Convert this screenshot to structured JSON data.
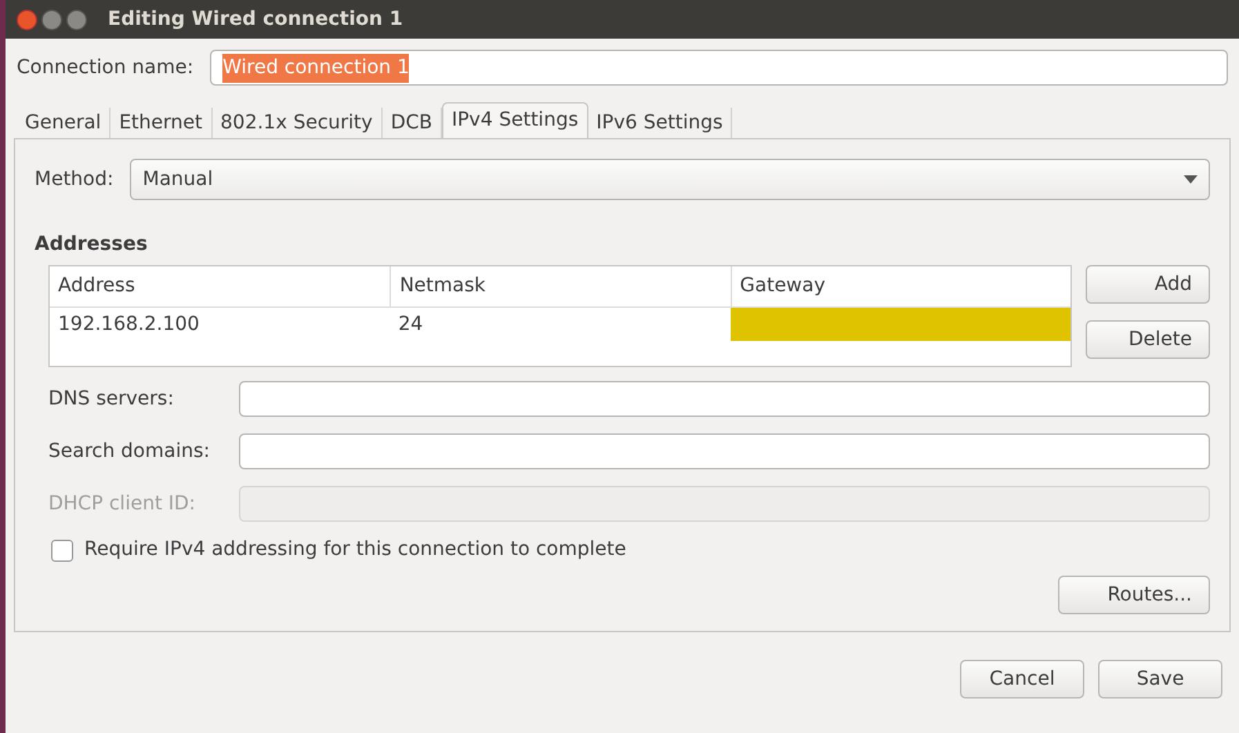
{
  "window": {
    "title": "Editing Wired connection 1"
  },
  "connection_name": {
    "label": "Connection name:",
    "value": "Wired connection 1",
    "selected_text": true
  },
  "tabs": [
    {
      "label": "General",
      "selected": false
    },
    {
      "label": "Ethernet",
      "selected": false
    },
    {
      "label": "802.1x Security",
      "selected": false
    },
    {
      "label": "DCB",
      "selected": false
    },
    {
      "label": "IPv4 Settings",
      "selected": true
    },
    {
      "label": "IPv6 Settings",
      "selected": false
    }
  ],
  "method": {
    "label": "Method:",
    "value": "Manual"
  },
  "addresses": {
    "title": "Addresses",
    "columns": [
      "Address",
      "Netmask",
      "Gateway"
    ],
    "rows": [
      {
        "cells": [
          {
            "text": "192.168.2.100",
            "editing": false
          },
          {
            "text": "24",
            "editing": false
          },
          {
            "text": "",
            "editing": true
          }
        ]
      }
    ],
    "buttons": [
      "Add",
      "Delete"
    ]
  },
  "fields": [
    {
      "label": "DNS servers:",
      "disabled": false
    },
    {
      "label": "Search domains:",
      "disabled": false
    },
    {
      "label": "DHCP client ID:",
      "disabled": true
    }
  ],
  "require_checkbox": {
    "label": "Require IPv4 addressing for this connection to complete",
    "checked": false
  },
  "routes_button": "Routes...",
  "buttons": [
    "Cancel",
    "Save"
  ]
}
